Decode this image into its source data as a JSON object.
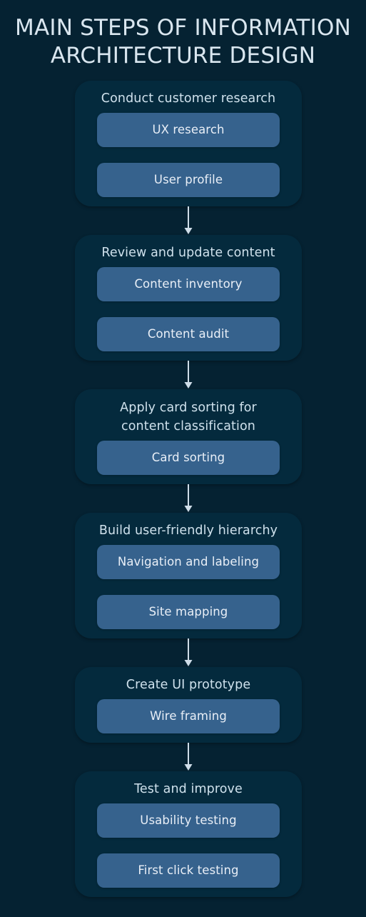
{
  "poster": {
    "title_lines": [
      "Main steps of information",
      "architecture design"
    ],
    "title_full": "MAIN STEPS OF INFORMATION ARCHITECTURE DESIGN",
    "colors": {
      "background": "#052232",
      "card_background": "#042a3d",
      "pill_background": "#36628d",
      "title_text": "#d9e6ef",
      "card_title_text": "#cfe1ec",
      "pill_text": "#e9eff7",
      "arrow": "#cfdde8"
    }
  },
  "steps": [
    {
      "index": 1,
      "title": "Conduct customer research",
      "items": [
        "UX research",
        "User profile"
      ]
    },
    {
      "index": 2,
      "title": "Review and update content",
      "items": [
        "Content inventory",
        "Content audit"
      ]
    },
    {
      "index": 3,
      "title": "Apply card sorting for\ncontent classification",
      "items": [
        "Card sorting"
      ]
    },
    {
      "index": 4,
      "title": "Build user-friendly hierarchy",
      "items": [
        "Navigation and labeling",
        "Site mapping"
      ]
    },
    {
      "index": 5,
      "title": "Create UI prototype",
      "items": [
        "Wire framing"
      ]
    },
    {
      "index": 6,
      "title": "Test and improve",
      "items": [
        "Usability testing",
        "First click testing"
      ]
    }
  ],
  "connectors": {
    "icon": "arrow-down-icon",
    "count": 5
  }
}
